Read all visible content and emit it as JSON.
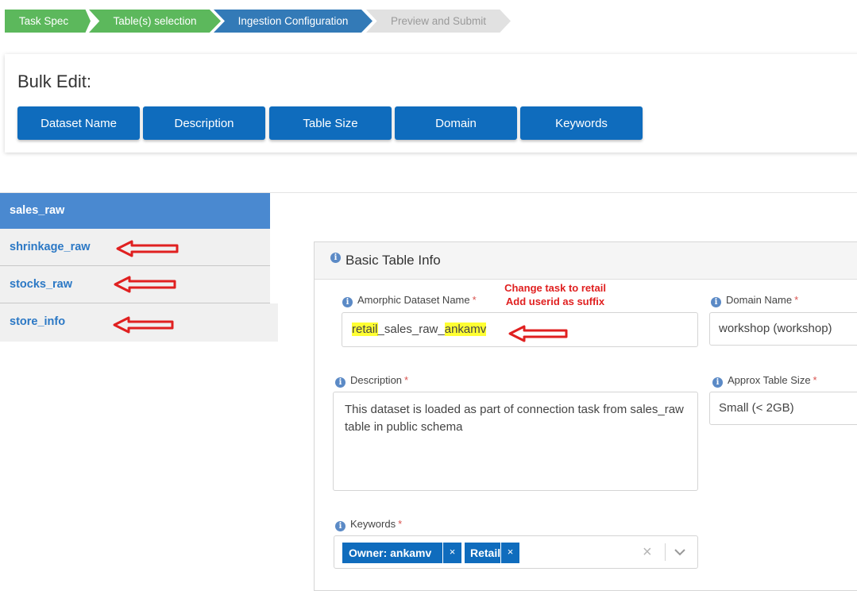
{
  "wizard": {
    "steps": [
      {
        "label": "Task Spec",
        "state": "done"
      },
      {
        "label": "Table(s) selection",
        "state": "done"
      },
      {
        "label": "Ingestion Configuration",
        "state": "active"
      },
      {
        "label": "Preview and Submit",
        "state": "todo"
      }
    ]
  },
  "bulk_edit": {
    "title": "Bulk Edit:",
    "buttons": [
      "Dataset Name",
      "Description",
      "Table Size",
      "Domain",
      "Keywords"
    ]
  },
  "tables": {
    "items": [
      {
        "label": "sales_raw",
        "active": true
      },
      {
        "label": "shrinkage_raw",
        "active": false
      },
      {
        "label": "stocks_raw",
        "active": false
      },
      {
        "label": "store_info",
        "active": false
      }
    ]
  },
  "basic_info": {
    "title": "Basic Table Info",
    "dataset_name": {
      "label": "Amorphic Dataset Name",
      "value_prefix": "retail",
      "value_middle": "_sales_raw_",
      "value_suffix": "ankamv"
    },
    "domain": {
      "label": "Domain Name",
      "value": "workshop (workshop)"
    },
    "description": {
      "label": "Description",
      "value": "This dataset is loaded as part of connection task from sales_raw table in public schema"
    },
    "table_size": {
      "label": "Approx Table Size",
      "value": "Small (< 2GB)"
    },
    "keywords": {
      "label": "Keywords",
      "tags": [
        "Owner: ankamv",
        "Retail"
      ],
      "clear_glyph": "×",
      "dropdown_glyph": "⌄"
    }
  },
  "annotation": {
    "line1": "Change task to retail",
    "line2": "Add userid as suffix"
  },
  "colors": {
    "step_done": "#5cb85c",
    "step_active": "#337ab7",
    "step_todo": "#e1e1e1",
    "primary_button": "#0f6cbd",
    "active_table": "#4a89d0",
    "highlight": "#ffff33",
    "annotation": "#e02020"
  }
}
